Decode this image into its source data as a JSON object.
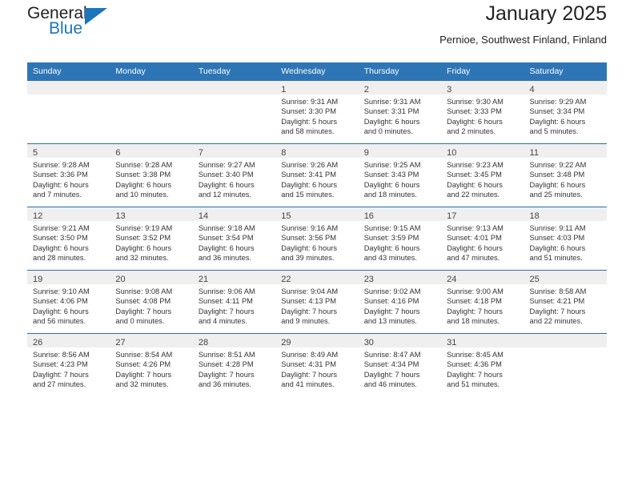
{
  "brand": {
    "name_top": "General",
    "name_bottom": "Blue",
    "triangle_color": "#1b75bb"
  },
  "header": {
    "title": "January 2025",
    "subtitle": "Pernioe, Southwest Finland, Finland"
  },
  "theme": {
    "header_bg": "#2e75b6",
    "row_divider": "#2e6fae",
    "daynum_bg": "#efefef",
    "text": "#333333"
  },
  "weekdays": [
    "Sunday",
    "Monday",
    "Tuesday",
    "Wednesday",
    "Thursday",
    "Friday",
    "Saturday"
  ],
  "weeks": [
    [
      {
        "day": "",
        "lines": []
      },
      {
        "day": "",
        "lines": []
      },
      {
        "day": "",
        "lines": []
      },
      {
        "day": "1",
        "lines": [
          "Sunrise: 9:31 AM",
          "Sunset: 3:30 PM",
          "Daylight: 5 hours",
          "and 58 minutes."
        ]
      },
      {
        "day": "2",
        "lines": [
          "Sunrise: 9:31 AM",
          "Sunset: 3:31 PM",
          "Daylight: 6 hours",
          "and 0 minutes."
        ]
      },
      {
        "day": "3",
        "lines": [
          "Sunrise: 9:30 AM",
          "Sunset: 3:33 PM",
          "Daylight: 6 hours",
          "and 2 minutes."
        ]
      },
      {
        "day": "4",
        "lines": [
          "Sunrise: 9:29 AM",
          "Sunset: 3:34 PM",
          "Daylight: 6 hours",
          "and 5 minutes."
        ]
      }
    ],
    [
      {
        "day": "5",
        "lines": [
          "Sunrise: 9:28 AM",
          "Sunset: 3:36 PM",
          "Daylight: 6 hours",
          "and 7 minutes."
        ]
      },
      {
        "day": "6",
        "lines": [
          "Sunrise: 9:28 AM",
          "Sunset: 3:38 PM",
          "Daylight: 6 hours",
          "and 10 minutes."
        ]
      },
      {
        "day": "7",
        "lines": [
          "Sunrise: 9:27 AM",
          "Sunset: 3:40 PM",
          "Daylight: 6 hours",
          "and 12 minutes."
        ]
      },
      {
        "day": "8",
        "lines": [
          "Sunrise: 9:26 AM",
          "Sunset: 3:41 PM",
          "Daylight: 6 hours",
          "and 15 minutes."
        ]
      },
      {
        "day": "9",
        "lines": [
          "Sunrise: 9:25 AM",
          "Sunset: 3:43 PM",
          "Daylight: 6 hours",
          "and 18 minutes."
        ]
      },
      {
        "day": "10",
        "lines": [
          "Sunrise: 9:23 AM",
          "Sunset: 3:45 PM",
          "Daylight: 6 hours",
          "and 22 minutes."
        ]
      },
      {
        "day": "11",
        "lines": [
          "Sunrise: 9:22 AM",
          "Sunset: 3:48 PM",
          "Daylight: 6 hours",
          "and 25 minutes."
        ]
      }
    ],
    [
      {
        "day": "12",
        "lines": [
          "Sunrise: 9:21 AM",
          "Sunset: 3:50 PM",
          "Daylight: 6 hours",
          "and 28 minutes."
        ]
      },
      {
        "day": "13",
        "lines": [
          "Sunrise: 9:19 AM",
          "Sunset: 3:52 PM",
          "Daylight: 6 hours",
          "and 32 minutes."
        ]
      },
      {
        "day": "14",
        "lines": [
          "Sunrise: 9:18 AM",
          "Sunset: 3:54 PM",
          "Daylight: 6 hours",
          "and 36 minutes."
        ]
      },
      {
        "day": "15",
        "lines": [
          "Sunrise: 9:16 AM",
          "Sunset: 3:56 PM",
          "Daylight: 6 hours",
          "and 39 minutes."
        ]
      },
      {
        "day": "16",
        "lines": [
          "Sunrise: 9:15 AM",
          "Sunset: 3:59 PM",
          "Daylight: 6 hours",
          "and 43 minutes."
        ]
      },
      {
        "day": "17",
        "lines": [
          "Sunrise: 9:13 AM",
          "Sunset: 4:01 PM",
          "Daylight: 6 hours",
          "and 47 minutes."
        ]
      },
      {
        "day": "18",
        "lines": [
          "Sunrise: 9:11 AM",
          "Sunset: 4:03 PM",
          "Daylight: 6 hours",
          "and 51 minutes."
        ]
      }
    ],
    [
      {
        "day": "19",
        "lines": [
          "Sunrise: 9:10 AM",
          "Sunset: 4:06 PM",
          "Daylight: 6 hours",
          "and 56 minutes."
        ]
      },
      {
        "day": "20",
        "lines": [
          "Sunrise: 9:08 AM",
          "Sunset: 4:08 PM",
          "Daylight: 7 hours",
          "and 0 minutes."
        ]
      },
      {
        "day": "21",
        "lines": [
          "Sunrise: 9:06 AM",
          "Sunset: 4:11 PM",
          "Daylight: 7 hours",
          "and 4 minutes."
        ]
      },
      {
        "day": "22",
        "lines": [
          "Sunrise: 9:04 AM",
          "Sunset: 4:13 PM",
          "Daylight: 7 hours",
          "and 9 minutes."
        ]
      },
      {
        "day": "23",
        "lines": [
          "Sunrise: 9:02 AM",
          "Sunset: 4:16 PM",
          "Daylight: 7 hours",
          "and 13 minutes."
        ]
      },
      {
        "day": "24",
        "lines": [
          "Sunrise: 9:00 AM",
          "Sunset: 4:18 PM",
          "Daylight: 7 hours",
          "and 18 minutes."
        ]
      },
      {
        "day": "25",
        "lines": [
          "Sunrise: 8:58 AM",
          "Sunset: 4:21 PM",
          "Daylight: 7 hours",
          "and 22 minutes."
        ]
      }
    ],
    [
      {
        "day": "26",
        "lines": [
          "Sunrise: 8:56 AM",
          "Sunset: 4:23 PM",
          "Daylight: 7 hours",
          "and 27 minutes."
        ]
      },
      {
        "day": "27",
        "lines": [
          "Sunrise: 8:54 AM",
          "Sunset: 4:26 PM",
          "Daylight: 7 hours",
          "and 32 minutes."
        ]
      },
      {
        "day": "28",
        "lines": [
          "Sunrise: 8:51 AM",
          "Sunset: 4:28 PM",
          "Daylight: 7 hours",
          "and 36 minutes."
        ]
      },
      {
        "day": "29",
        "lines": [
          "Sunrise: 8:49 AM",
          "Sunset: 4:31 PM",
          "Daylight: 7 hours",
          "and 41 minutes."
        ]
      },
      {
        "day": "30",
        "lines": [
          "Sunrise: 8:47 AM",
          "Sunset: 4:34 PM",
          "Daylight: 7 hours",
          "and 46 minutes."
        ]
      },
      {
        "day": "31",
        "lines": [
          "Sunrise: 8:45 AM",
          "Sunset: 4:36 PM",
          "Daylight: 7 hours",
          "and 51 minutes."
        ]
      },
      {
        "day": "",
        "lines": []
      }
    ]
  ]
}
